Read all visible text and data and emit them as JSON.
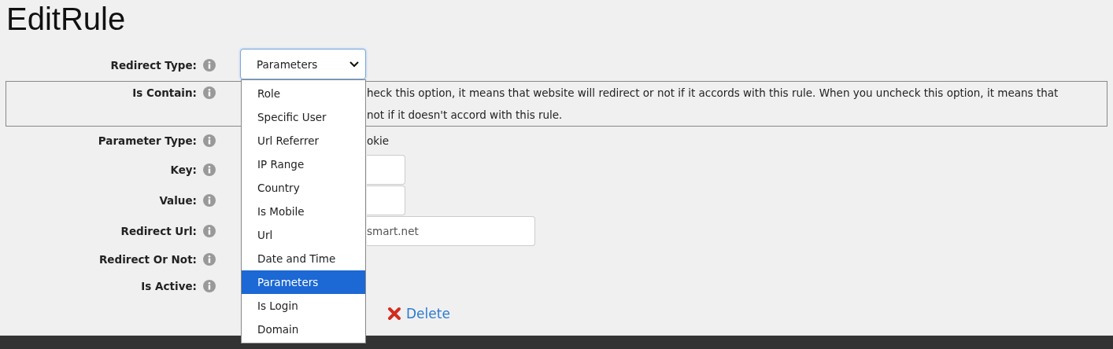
{
  "title": "EditRule",
  "redirect_type": {
    "label": "Redirect Type:",
    "value": "Parameters",
    "expanded": true,
    "options": [
      {
        "label": "Role",
        "selected": false
      },
      {
        "label": "Specific User",
        "selected": false
      },
      {
        "label": "Url Referrer",
        "selected": false
      },
      {
        "label": "IP Range",
        "selected": false
      },
      {
        "label": "Country",
        "selected": false
      },
      {
        "label": "Is Mobile",
        "selected": false
      },
      {
        "label": "Url",
        "selected": false
      },
      {
        "label": "Date and Time",
        "selected": false
      },
      {
        "label": "Parameters",
        "selected": true
      },
      {
        "label": "Is Login",
        "selected": false
      },
      {
        "label": "Domain",
        "selected": false
      }
    ]
  },
  "rows": [
    {
      "kind": "note",
      "label": "Is Contain:",
      "lines": [
        "heck this option, it means that website will redirect or not if it accords with this rule. When you uncheck this option, it means that",
        "not if it doesn't accord with this rule."
      ]
    },
    {
      "kind": "text",
      "label": "Parameter Type:",
      "text": "okie"
    },
    {
      "kind": "input",
      "label": "Key:"
    },
    {
      "kind": "input",
      "label": "Value:"
    },
    {
      "kind": "wide_input",
      "label": "Redirect Url:",
      "value": "smart.net"
    },
    {
      "kind": "empty",
      "label": "Redirect Or Not:"
    },
    {
      "kind": "empty",
      "label": "Is Active:"
    }
  ],
  "delete_link": "Delete"
}
